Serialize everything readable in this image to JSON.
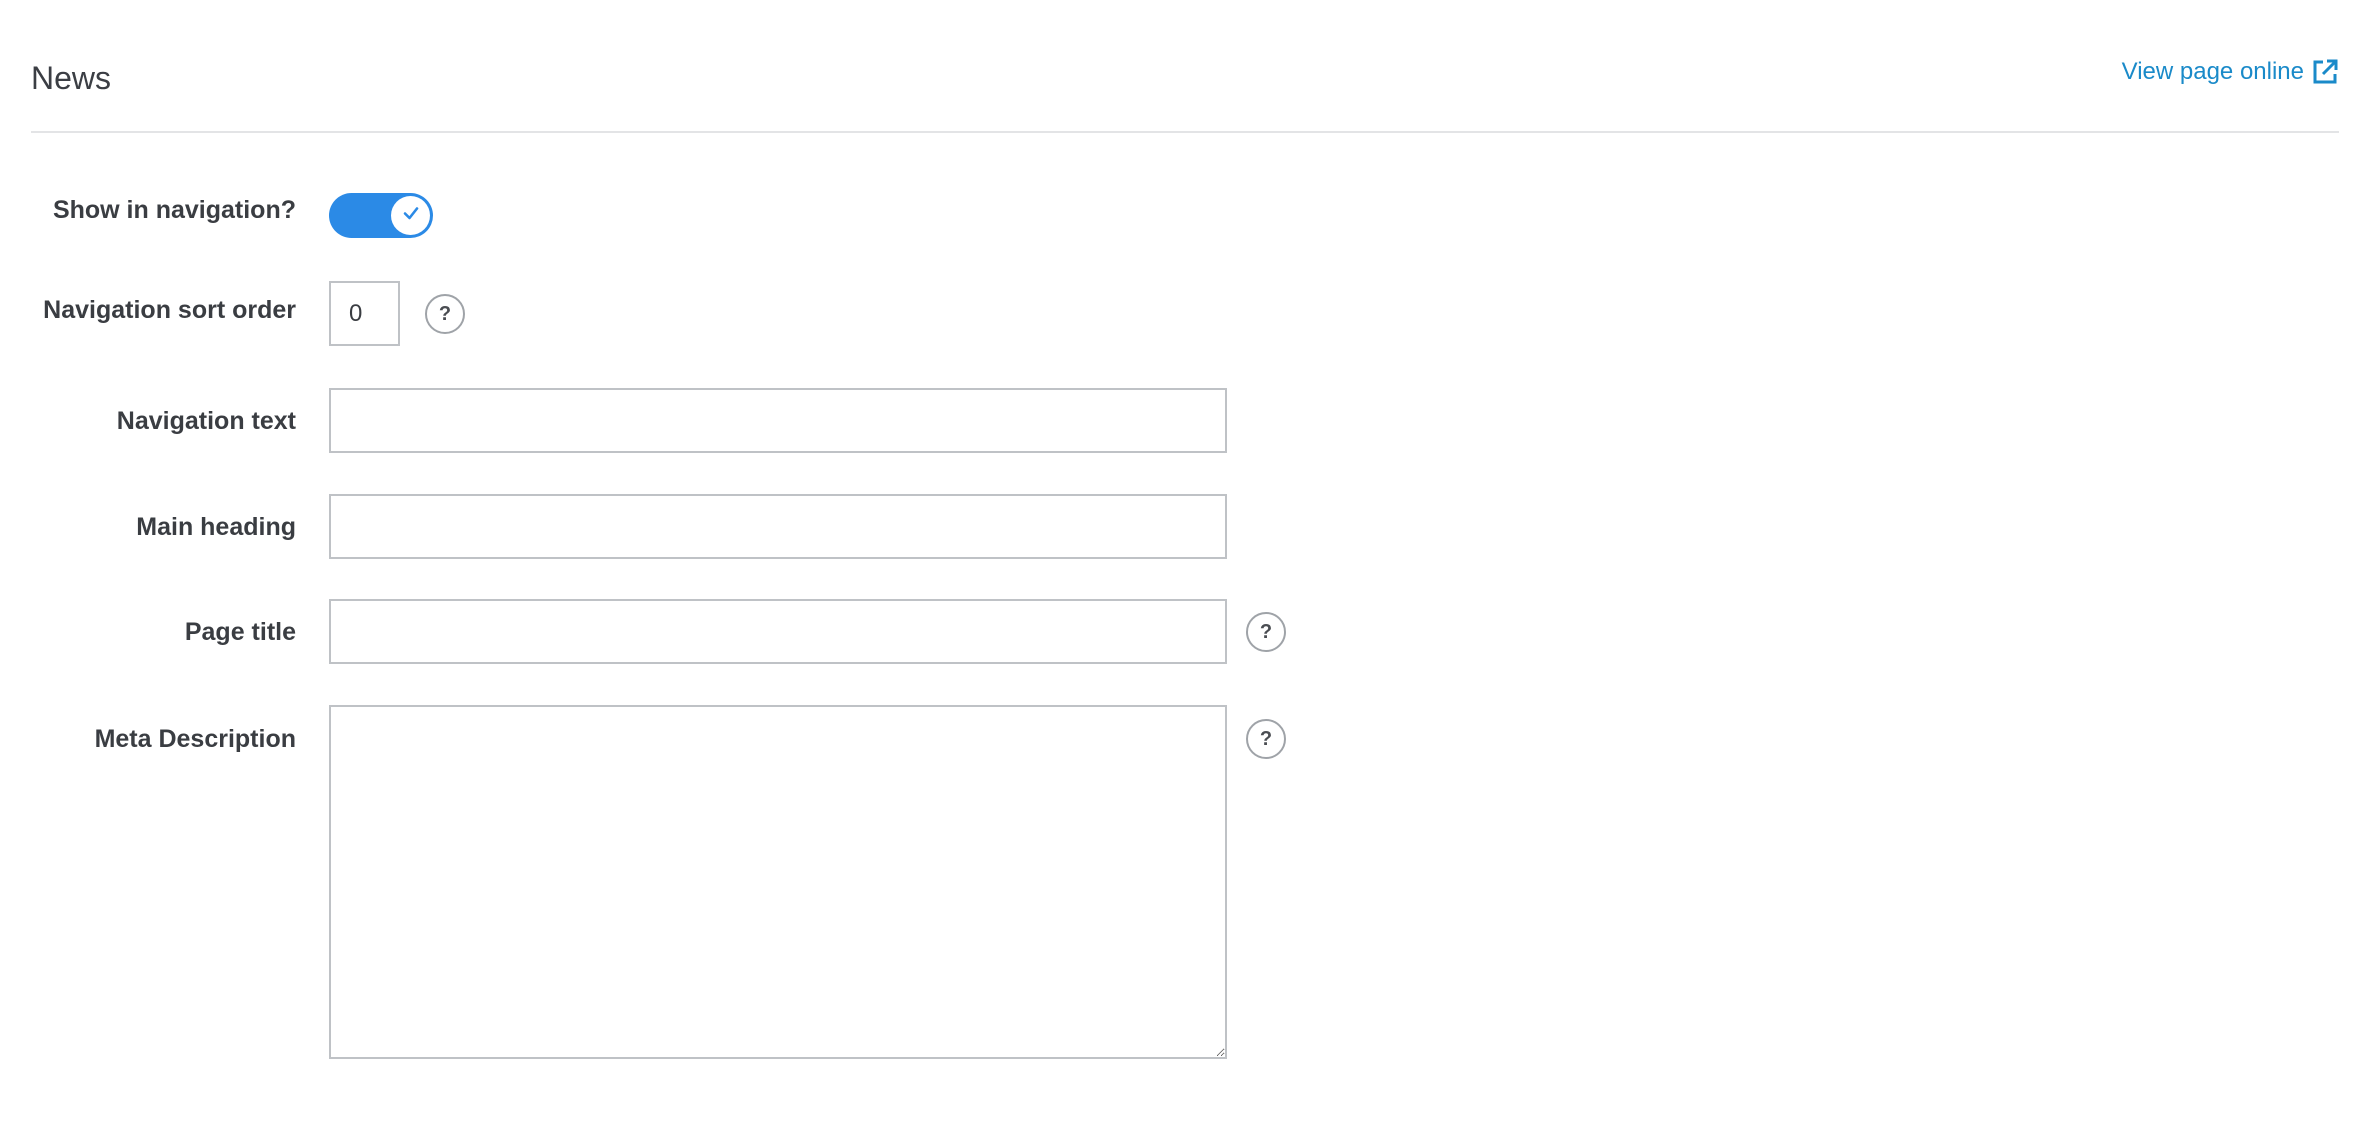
{
  "header": {
    "title": "News",
    "view_link_label": "View page online",
    "view_link_icon": "external-link-icon",
    "link_color": "#1a8ac9"
  },
  "form": {
    "show_in_navigation": {
      "label": "Show in navigation?",
      "checked": true,
      "icon": "check-icon",
      "toggle_color": "#2b8ae6"
    },
    "sort_order": {
      "label": "Navigation sort order",
      "value": "0",
      "help": "?"
    },
    "navigation_text": {
      "label": "Navigation text",
      "value": ""
    },
    "main_heading": {
      "label": "Main heading",
      "value": ""
    },
    "page_title": {
      "label": "Page title",
      "value": "",
      "help": "?"
    },
    "meta_description": {
      "label": "Meta Description",
      "value": "",
      "help": "?"
    }
  }
}
